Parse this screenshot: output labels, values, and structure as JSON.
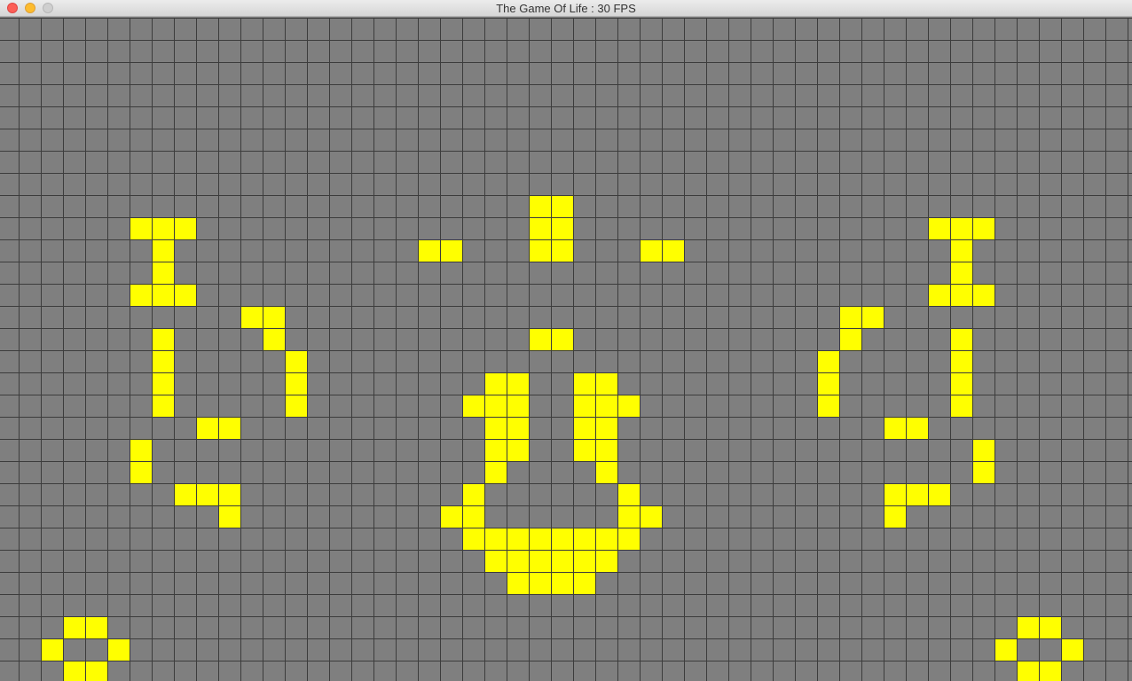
{
  "window": {
    "title": "The Game Of Life : 30 FPS",
    "controls": [
      {
        "name": "close",
        "color": "#fc5f57"
      },
      {
        "name": "minimize",
        "color": "#fdbc2e"
      },
      {
        "name": "zoom",
        "color": "#cfcfcf"
      }
    ]
  },
  "board": {
    "columns": 51,
    "rows": 30,
    "background_color": "#7f7f7f",
    "grid_line_color": "#3c3c3c",
    "live_cell_color": "#ffff00",
    "live_cells": [
      [
        24,
        8
      ],
      [
        25,
        8
      ],
      [
        6,
        9
      ],
      [
        7,
        9
      ],
      [
        8,
        9
      ],
      [
        24,
        9
      ],
      [
        25,
        9
      ],
      [
        42,
        9
      ],
      [
        43,
        9
      ],
      [
        44,
        9
      ],
      [
        7,
        10
      ],
      [
        19,
        10
      ],
      [
        20,
        10
      ],
      [
        24,
        10
      ],
      [
        25,
        10
      ],
      [
        29,
        10
      ],
      [
        30,
        10
      ],
      [
        43,
        10
      ],
      [
        7,
        11
      ],
      [
        43,
        11
      ],
      [
        6,
        12
      ],
      [
        7,
        12
      ],
      [
        8,
        12
      ],
      [
        42,
        12
      ],
      [
        43,
        12
      ],
      [
        44,
        12
      ],
      [
        11,
        13
      ],
      [
        12,
        13
      ],
      [
        38,
        13
      ],
      [
        39,
        13
      ],
      [
        7,
        14
      ],
      [
        12,
        14
      ],
      [
        24,
        14
      ],
      [
        25,
        14
      ],
      [
        38,
        14
      ],
      [
        43,
        14
      ],
      [
        7,
        15
      ],
      [
        13,
        15
      ],
      [
        37,
        15
      ],
      [
        43,
        15
      ],
      [
        7,
        16
      ],
      [
        13,
        16
      ],
      [
        22,
        16
      ],
      [
        23,
        16
      ],
      [
        26,
        16
      ],
      [
        27,
        16
      ],
      [
        37,
        16
      ],
      [
        43,
        16
      ],
      [
        7,
        17
      ],
      [
        13,
        17
      ],
      [
        21,
        17
      ],
      [
        22,
        17
      ],
      [
        23,
        17
      ],
      [
        26,
        17
      ],
      [
        27,
        17
      ],
      [
        28,
        17
      ],
      [
        37,
        17
      ],
      [
        43,
        17
      ],
      [
        9,
        18
      ],
      [
        10,
        18
      ],
      [
        22,
        18
      ],
      [
        23,
        18
      ],
      [
        26,
        18
      ],
      [
        27,
        18
      ],
      [
        40,
        18
      ],
      [
        41,
        18
      ],
      [
        6,
        19
      ],
      [
        22,
        19
      ],
      [
        23,
        19
      ],
      [
        26,
        19
      ],
      [
        27,
        19
      ],
      [
        44,
        19
      ],
      [
        6,
        20
      ],
      [
        22,
        20
      ],
      [
        27,
        20
      ],
      [
        44,
        20
      ],
      [
        8,
        21
      ],
      [
        9,
        21
      ],
      [
        10,
        21
      ],
      [
        21,
        21
      ],
      [
        28,
        21
      ],
      [
        40,
        21
      ],
      [
        41,
        21
      ],
      [
        42,
        21
      ],
      [
        10,
        22
      ],
      [
        20,
        22
      ],
      [
        21,
        22
      ],
      [
        28,
        22
      ],
      [
        29,
        22
      ],
      [
        40,
        22
      ],
      [
        21,
        23
      ],
      [
        22,
        23
      ],
      [
        23,
        23
      ],
      [
        24,
        23
      ],
      [
        25,
        23
      ],
      [
        26,
        23
      ],
      [
        27,
        23
      ],
      [
        28,
        23
      ],
      [
        22,
        24
      ],
      [
        23,
        24
      ],
      [
        24,
        24
      ],
      [
        25,
        24
      ],
      [
        26,
        24
      ],
      [
        27,
        24
      ],
      [
        23,
        25
      ],
      [
        24,
        25
      ],
      [
        25,
        25
      ],
      [
        26,
        25
      ],
      [
        3,
        27
      ],
      [
        4,
        27
      ],
      [
        46,
        27
      ],
      [
        47,
        27
      ],
      [
        2,
        28
      ],
      [
        5,
        28
      ],
      [
        45,
        28
      ],
      [
        48,
        28
      ],
      [
        3,
        29
      ],
      [
        4,
        29
      ],
      [
        46,
        29
      ],
      [
        47,
        29
      ]
    ]
  }
}
